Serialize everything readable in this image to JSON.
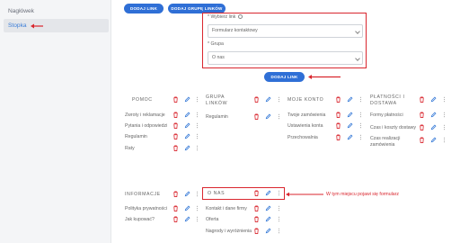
{
  "sidebar": {
    "items": [
      {
        "label": "Nagłówek",
        "active": false
      },
      {
        "label": "Stopka",
        "active": true
      }
    ]
  },
  "toolbar": {
    "add_link_label": "DODAJ LINK",
    "add_group_label": "DODAJ GRUPĘ LINKÓW"
  },
  "form": {
    "link_label": "* Wybierz link",
    "link_value": "Formularz kontaktowy",
    "group_label": "* Grupa",
    "group_value": "O nas",
    "submit_label": "DODAJ LINK"
  },
  "groups": [
    {
      "title": "POMOC",
      "items": [
        "Zwroty i reklamacje",
        "Pytania i odpowiedzi",
        "Regulamin",
        "Raty"
      ]
    },
    {
      "title": "GRUPA LINKÓW",
      "items": [
        "Regulamin"
      ]
    },
    {
      "title": "MOJE KONTO",
      "items": [
        "Twoje zamówienia",
        "Ustawienia konta",
        "Przechowalnia"
      ]
    },
    {
      "title": "PŁATNOŚCI I DOSTAWA",
      "items": [
        "Formy płatności",
        "Czas i koszty dostawy",
        "Czas realizacji zamówienia"
      ]
    },
    {
      "title": "INFORMACJE",
      "items": [
        "Polityka prywatności",
        "Jak kupować?"
      ]
    },
    {
      "title": "O NAS",
      "items": [
        "Kontakt i dane firmy",
        "Oferta",
        "Nagrody i wyróżnienia"
      ]
    }
  ],
  "annotation": "W tym miejscu pojawi się formularz",
  "colors": {
    "accent": "#2f6fd6",
    "danger": "#d9262e",
    "edit": "#3b7dd8"
  },
  "icons": {
    "delete": "trash-icon",
    "edit": "pencil-icon",
    "drag": "drag-handle-icon"
  }
}
